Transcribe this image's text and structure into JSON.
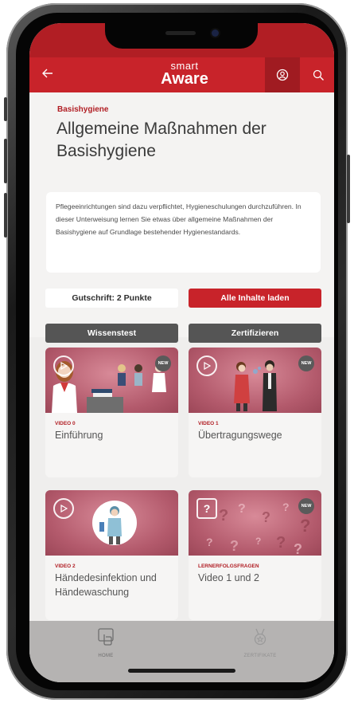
{
  "app": {
    "logo_top": "smart",
    "logo_bottom": "Aware"
  },
  "course": {
    "category": "Basishygiene",
    "title": "Allgemeine Maßnahmen der Basishygiene",
    "description": "Pflegeeinrichtungen sind dazu verpflichtet, Hygieneschulungen durchzuführen. In dieser Unterweisung lernen Sie etwas über allgemeine Maßnahmen der Basishygiene auf Grundlage bestehender Hygienestandards."
  },
  "actions": {
    "credit_label": "Gutschrift: 2 Punkte",
    "load_all_label": "Alle Inhalte laden",
    "quiz_label": "Wissenstest",
    "certify_label": "Zertifizieren"
  },
  "tiles": [
    {
      "type": "VIDEO 0",
      "title": "Einführung",
      "badge": "NEW"
    },
    {
      "type": "VIDEO 1",
      "title": "Übertragungswege",
      "badge": "NEW"
    },
    {
      "type": "VIDEO 2",
      "title": "Händedesinfektion und Händewaschung",
      "badge": ""
    },
    {
      "type": "LERNERFOLGSFRAGEN",
      "title": "Video 1 und 2",
      "badge": "NEW"
    }
  ],
  "tabbar": {
    "home_label": "HOME",
    "certificates_label": "ZERTIFIKATE"
  },
  "colors": {
    "brand_red": "#c8232a",
    "dark_red": "#b11e24",
    "button_gray": "#555555",
    "tabbar": "#b5b3b2"
  },
  "icons": [
    "back-arrow-icon",
    "account-icon",
    "search-icon",
    "play-icon",
    "question-icon",
    "home-touch-icon",
    "medal-icon"
  ]
}
